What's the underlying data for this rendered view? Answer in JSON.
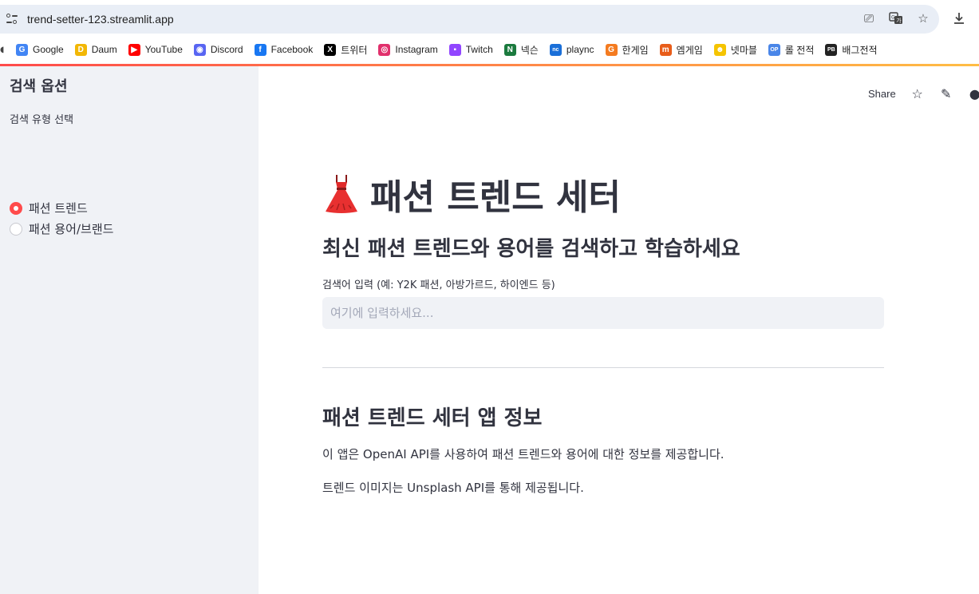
{
  "browser": {
    "url": "trend-setter-123.streamlit.app",
    "bookmarks": [
      {
        "label": "Google",
        "icon": "google-icon",
        "color": "#4285f4",
        "glyph": "G"
      },
      {
        "label": "Daum",
        "icon": "daum-icon",
        "color": "#f2b705",
        "glyph": "D"
      },
      {
        "label": "YouTube",
        "icon": "youtube-icon",
        "color": "#ff0000",
        "glyph": "▶"
      },
      {
        "label": "Discord",
        "icon": "discord-icon",
        "color": "#5865f2",
        "glyph": "◉"
      },
      {
        "label": "Facebook",
        "icon": "facebook-icon",
        "color": "#1877f2",
        "glyph": "f"
      },
      {
        "label": "트위터",
        "icon": "x-icon",
        "color": "#000000",
        "glyph": "X"
      },
      {
        "label": "Instagram",
        "icon": "instagram-icon",
        "color": "#e1306c",
        "glyph": "◎"
      },
      {
        "label": "Twitch",
        "icon": "twitch-icon",
        "color": "#9146ff",
        "glyph": "▪"
      },
      {
        "label": "넥슨",
        "icon": "nexon-icon",
        "color": "#1b7a3e",
        "glyph": "N"
      },
      {
        "label": "plaync",
        "icon": "plaync-icon",
        "color": "#1a6fd8",
        "glyph": "nc"
      },
      {
        "label": "한게임",
        "icon": "hangame-icon",
        "color": "#f47b20",
        "glyph": "G"
      },
      {
        "label": "엠게임",
        "icon": "mgame-icon",
        "color": "#e85d1a",
        "glyph": "m"
      },
      {
        "label": "넷마블",
        "icon": "netmarble-icon",
        "color": "#f5c400",
        "glyph": "☻"
      },
      {
        "label": "롤 전적",
        "icon": "lol-stats-icon",
        "color": "#4a86e8",
        "glyph": "OP"
      },
      {
        "label": "배그전적",
        "icon": "pubg-stats-icon",
        "color": "#222222",
        "glyph": "PB"
      }
    ]
  },
  "toolbar": {
    "share_label": "Share"
  },
  "sidebar": {
    "title": "검색 옵션",
    "radio_label": "검색 유형 선택",
    "options": [
      {
        "label": "패션 트렌드",
        "selected": true
      },
      {
        "label": "패션 용어/브랜드",
        "selected": false
      }
    ]
  },
  "main": {
    "title": "패션 트렌드 세터",
    "title_icon": "dress-icon",
    "subtitle": "최신 패션 트렌드와 용어를 검색하고 학습하세요",
    "search": {
      "label": "검색어 입력 (예: Y2K 패션, 아방가르드, 하이엔드 등)",
      "placeholder": "여기에 입력하세요...",
      "value": ""
    },
    "info": {
      "title": "패션 트렌드 세터 앱 정보",
      "paragraphs": [
        "이 앱은 OpenAI API를 사용하여 패션 트렌드와 용어에 대한 정보를 제공합니다.",
        "트렌드 이미지는 Unsplash API를 통해 제공됩니다."
      ]
    }
  },
  "colors": {
    "accent": "#ff4b4b",
    "sidebar_bg": "#f0f2f6",
    "text": "#31333f"
  }
}
